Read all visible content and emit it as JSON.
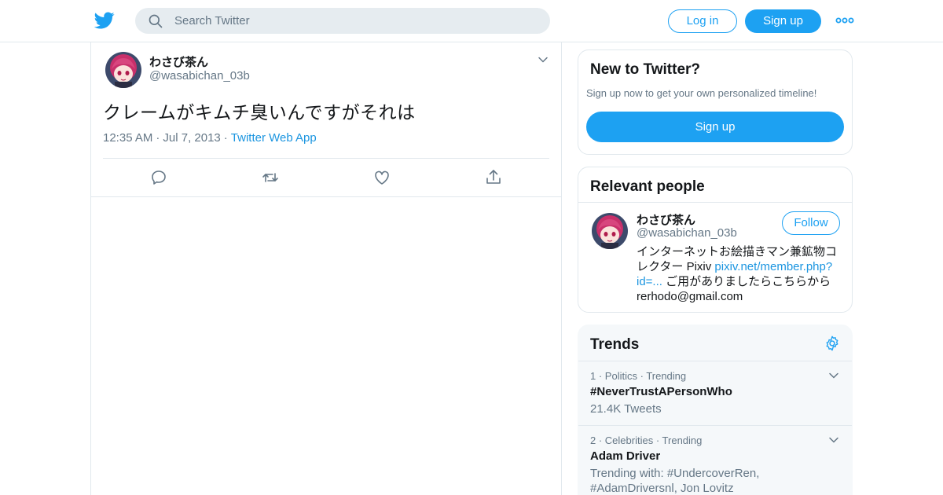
{
  "header": {
    "search_placeholder": "Search Twitter",
    "login_label": "Log in",
    "signup_label": "Sign up",
    "logo_icon": "twitter-bird-icon",
    "more_icon": "more-dots-icon"
  },
  "tweet": {
    "display_name": "わさび茶ん",
    "handle": "@wasabichan_03b",
    "text": "クレームがキムチ臭いんですがそれは",
    "time": "12:35 AM",
    "date": "Jul 7, 2013",
    "source": "Twitter Web App",
    "actions": [
      "reply-icon",
      "retweet-icon",
      "like-icon",
      "share-icon"
    ]
  },
  "sidebar": {
    "new_to_twitter": {
      "title": "New to Twitter?",
      "subtitle": "Sign up now to get your own personalized timeline!",
      "button": "Sign up"
    },
    "relevant_people": {
      "title": "Relevant people",
      "display_name": "わさび茶ん",
      "handle": "@wasabichan_03b",
      "follow_label": "Follow",
      "bio_1": "インターネットお絵描きマン兼鉱物コレクター Pixiv ",
      "bio_link": "pixiv.net/member.php?id=...",
      "bio_2": " ご用がありましたらこちらから rerhodo@gmail.com"
    },
    "trends": {
      "title": "Trends",
      "items": [
        {
          "rank": "1",
          "category": "Politics",
          "status": "Trending",
          "name": "#NeverTrustAPersonWho",
          "detail": "21.4K Tweets"
        },
        {
          "rank": "2",
          "category": "Celebrities",
          "status": "Trending",
          "name": "Adam Driver",
          "detail": "Trending with: #UndercoverRen, #AdamDriversnl, Jon Lovitz"
        }
      ]
    }
  },
  "colors": {
    "accent": "#1da1f2",
    "link": "#1b95e0",
    "muted": "#657786",
    "border": "#e1e8ed"
  }
}
